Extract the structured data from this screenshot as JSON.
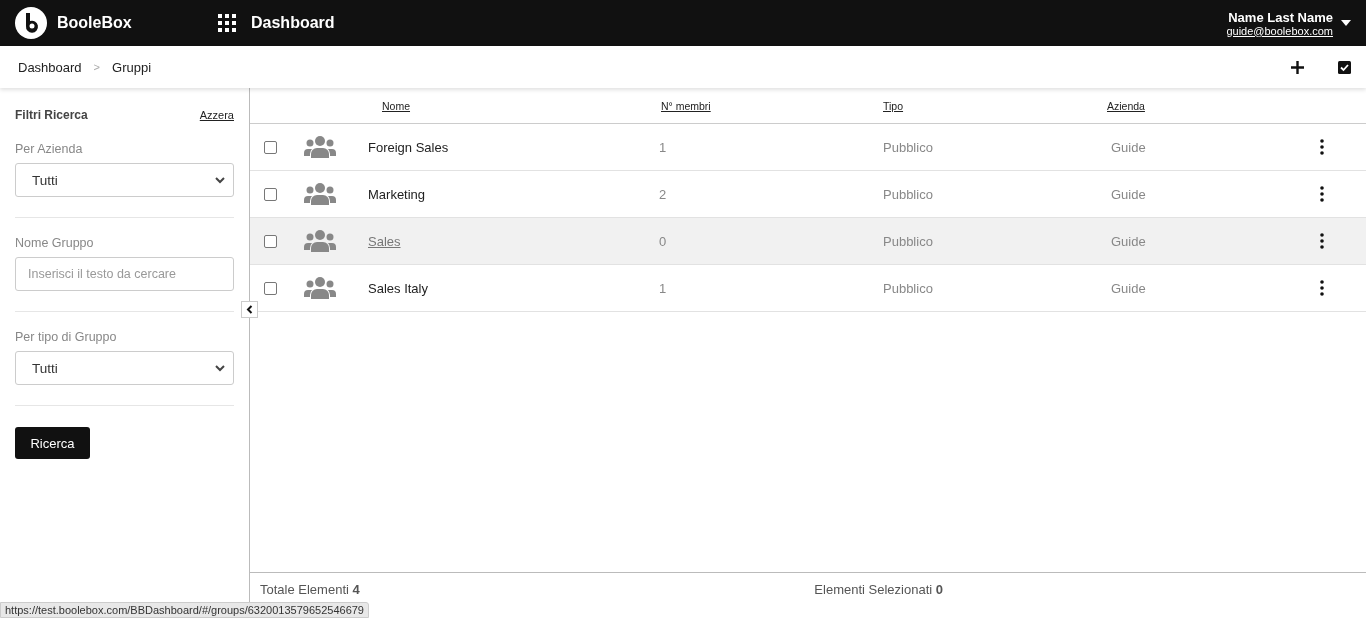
{
  "topbar": {
    "brand": "BooleBox",
    "title": "Dashboard",
    "user_name": "Name Last Name",
    "user_email": "guide@boolebox.com"
  },
  "breadcrumb": [
    "Dashboard",
    "Gruppi"
  ],
  "breadcrumb_separator": ">",
  "sidebar": {
    "title": "Filtri Ricerca",
    "reset": "Azzera",
    "filters": [
      {
        "kind": "select",
        "label": "Per Azienda",
        "value": "Tutti"
      },
      {
        "kind": "text",
        "label": "Nome Gruppo",
        "placeholder": "Inserisci il testo da cercare"
      },
      {
        "kind": "select",
        "label": "Per tipo di Gruppo",
        "value": "Tutti"
      }
    ],
    "search_button": "Ricerca"
  },
  "table": {
    "columns": [
      "Nome",
      "N° membri",
      "Tipo",
      "Azienda"
    ],
    "rows": [
      {
        "name": "Foreign Sales",
        "members": "1",
        "type": "Pubblico",
        "company": "Guide",
        "checked": false,
        "hovered": false
      },
      {
        "name": "Marketing",
        "members": "2",
        "type": "Pubblico",
        "company": "Guide",
        "checked": false,
        "hovered": false
      },
      {
        "name": "Sales",
        "members": "0",
        "type": "Pubblico",
        "company": "Guide",
        "checked": false,
        "hovered": true
      },
      {
        "name": "Sales Italy",
        "members": "1",
        "type": "Pubblico",
        "company": "Guide",
        "checked": false,
        "hovered": false
      }
    ]
  },
  "footer": {
    "total_label": "Totale Elementi",
    "total": "4",
    "selected_label": "Elementi Selezionati",
    "selected": "0"
  },
  "status_url": "https://test.boolebox.com/BBDashboard/#/groups/6320013579652546679"
}
